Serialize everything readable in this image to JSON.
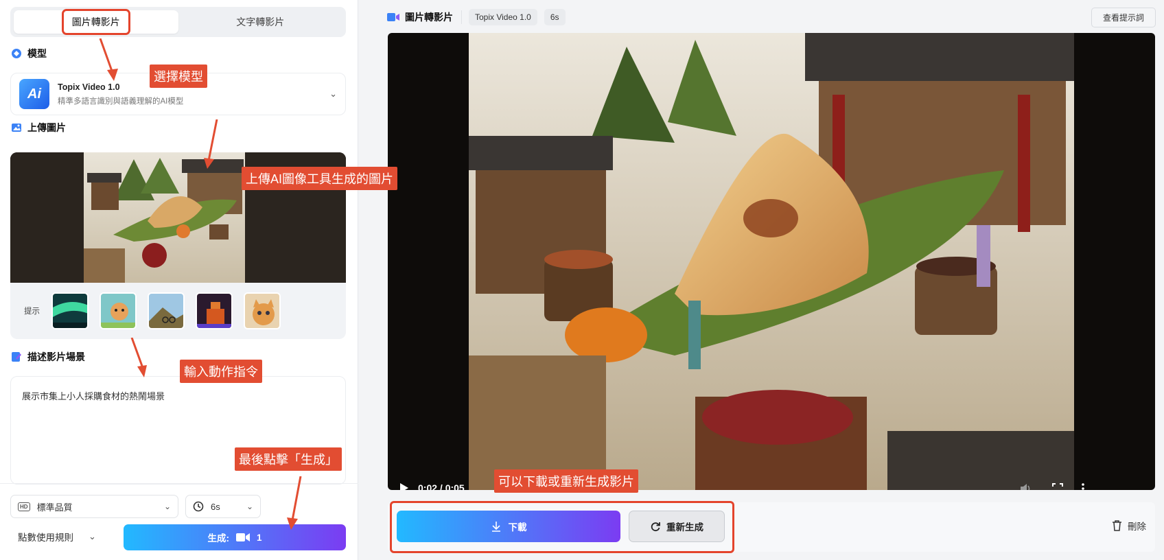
{
  "tabs": {
    "image_to_video": "圖片轉影片",
    "text_to_video": "文字轉影片"
  },
  "model": {
    "section_title": "模型",
    "name": "Topix Video 1.0",
    "description": "精準多語言識別與語義理解的AI模型",
    "logo_text": "Ai"
  },
  "upload": {
    "section_title": "上傳圖片",
    "prompt_label": "提示"
  },
  "describe": {
    "section_title": "描述影片場景",
    "text": "展示市集上小人採購食材的熱鬧場景"
  },
  "settings": {
    "quality_badge": "HD",
    "quality": "標準品質",
    "duration": "6s",
    "rules": "點數使用規則",
    "generate_label": "生成:",
    "generate_cost": "1"
  },
  "header": {
    "title": "圖片轉影片",
    "model_chip": "Topix Video 1.0",
    "duration_chip": "6s",
    "view_prompt": "查看提示詞"
  },
  "video": {
    "time": "0:02 / 0:05",
    "progress": 0.4
  },
  "actions": {
    "download": "下載",
    "regenerate": "重新生成",
    "delete": "刪除"
  },
  "annotations": {
    "select_model": "選擇模型",
    "upload_image": "上傳AI圖像工具生成的圖片",
    "enter_prompt": "輸入動作指令",
    "click_generate": "最後點擊「生成」",
    "download_or_regen": "可以下載或重新生成影片"
  },
  "colors": {
    "accent_start": "#22b9ff",
    "accent_end": "#7b3cf2",
    "annotation": "#e24d32"
  }
}
